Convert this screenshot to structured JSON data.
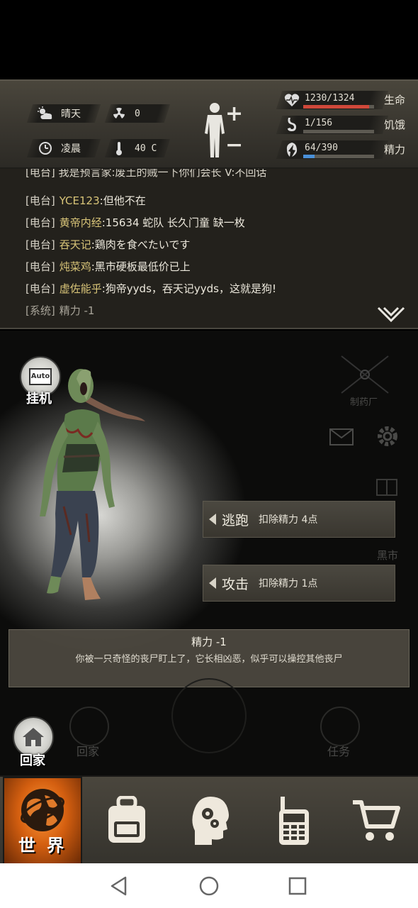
{
  "status": {
    "weather": {
      "label": "晴天",
      "icon": "cloud-sun-icon"
    },
    "radiation": {
      "value": "0",
      "icon": "radiation-icon"
    },
    "time": {
      "label": "凌晨",
      "icon": "clock-icon"
    },
    "temperature": {
      "value": "40 C",
      "icon": "thermometer-icon"
    },
    "body_icon": "body-silhouette-icon",
    "zoom_in": "+",
    "zoom_out": "−",
    "stats": [
      {
        "name": "生命",
        "text": "1230/1324",
        "current": 1230,
        "max": 1324,
        "color": "#d0483a",
        "icon": "heart-pulse-icon"
      },
      {
        "name": "饥饿",
        "text": "1/156",
        "current": 1,
        "max": 156,
        "color": "#5c5a55",
        "icon": "stomach-icon"
      },
      {
        "name": "精力",
        "text": "64/390",
        "current": 64,
        "max": 390,
        "color": "#4a90d8",
        "icon": "energy-icon"
      }
    ]
  },
  "chat": {
    "partial_line": "[电台] 我是预言家:废土的贼一下你们会长 V:不回话",
    "lines": [
      {
        "tag": "[电台]",
        "name": "YCE123",
        "msg": ":但他不在"
      },
      {
        "tag": "[电台]",
        "name": "黄帝内经",
        "msg": ":15634 蛇队 长久门童 缺一枚"
      },
      {
        "tag": "[电台]",
        "name": "吞天记",
        "msg": ":鶏肉を食べたいです"
      },
      {
        "tag": "[电台]",
        "name": "炖菜鸡",
        "msg": ":黑市硬板最低价已上"
      },
      {
        "tag": "[电台]",
        "name": "虚佐能乎",
        "msg": ":狗帝yyds，吞天记yyds，这就是狗!"
      }
    ],
    "system_line": {
      "tag": "[系统]",
      "msg": "精力 -1"
    },
    "collapse_icon": "chevron-down-icon"
  },
  "scene": {
    "auto_label": "挂机",
    "auto_badge": "Auto",
    "faded_labels": {
      "pharmacy": "制药厂",
      "black_market": "黑市",
      "home": "回家",
      "tasks": "任务"
    },
    "actions": [
      {
        "title": "逃跑",
        "cost": "扣除精力 4点"
      },
      {
        "title": "攻击",
        "cost": "扣除精力 1点"
      }
    ],
    "info": {
      "title": "精力 -1",
      "desc": "你被一只奇怪的丧尸盯上了，它长相凶恶，似乎可以操控其他丧尸"
    },
    "home_label": "回家"
  },
  "tabs": [
    {
      "label": "世 界",
      "icon": "globe-icon",
      "active": true
    },
    {
      "label": "",
      "icon": "backpack-icon",
      "active": false
    },
    {
      "label": "",
      "icon": "head-gears-icon",
      "active": false
    },
    {
      "label": "",
      "icon": "walkie-talkie-icon",
      "active": false
    },
    {
      "label": "",
      "icon": "shopping-cart-icon",
      "active": false
    }
  ]
}
